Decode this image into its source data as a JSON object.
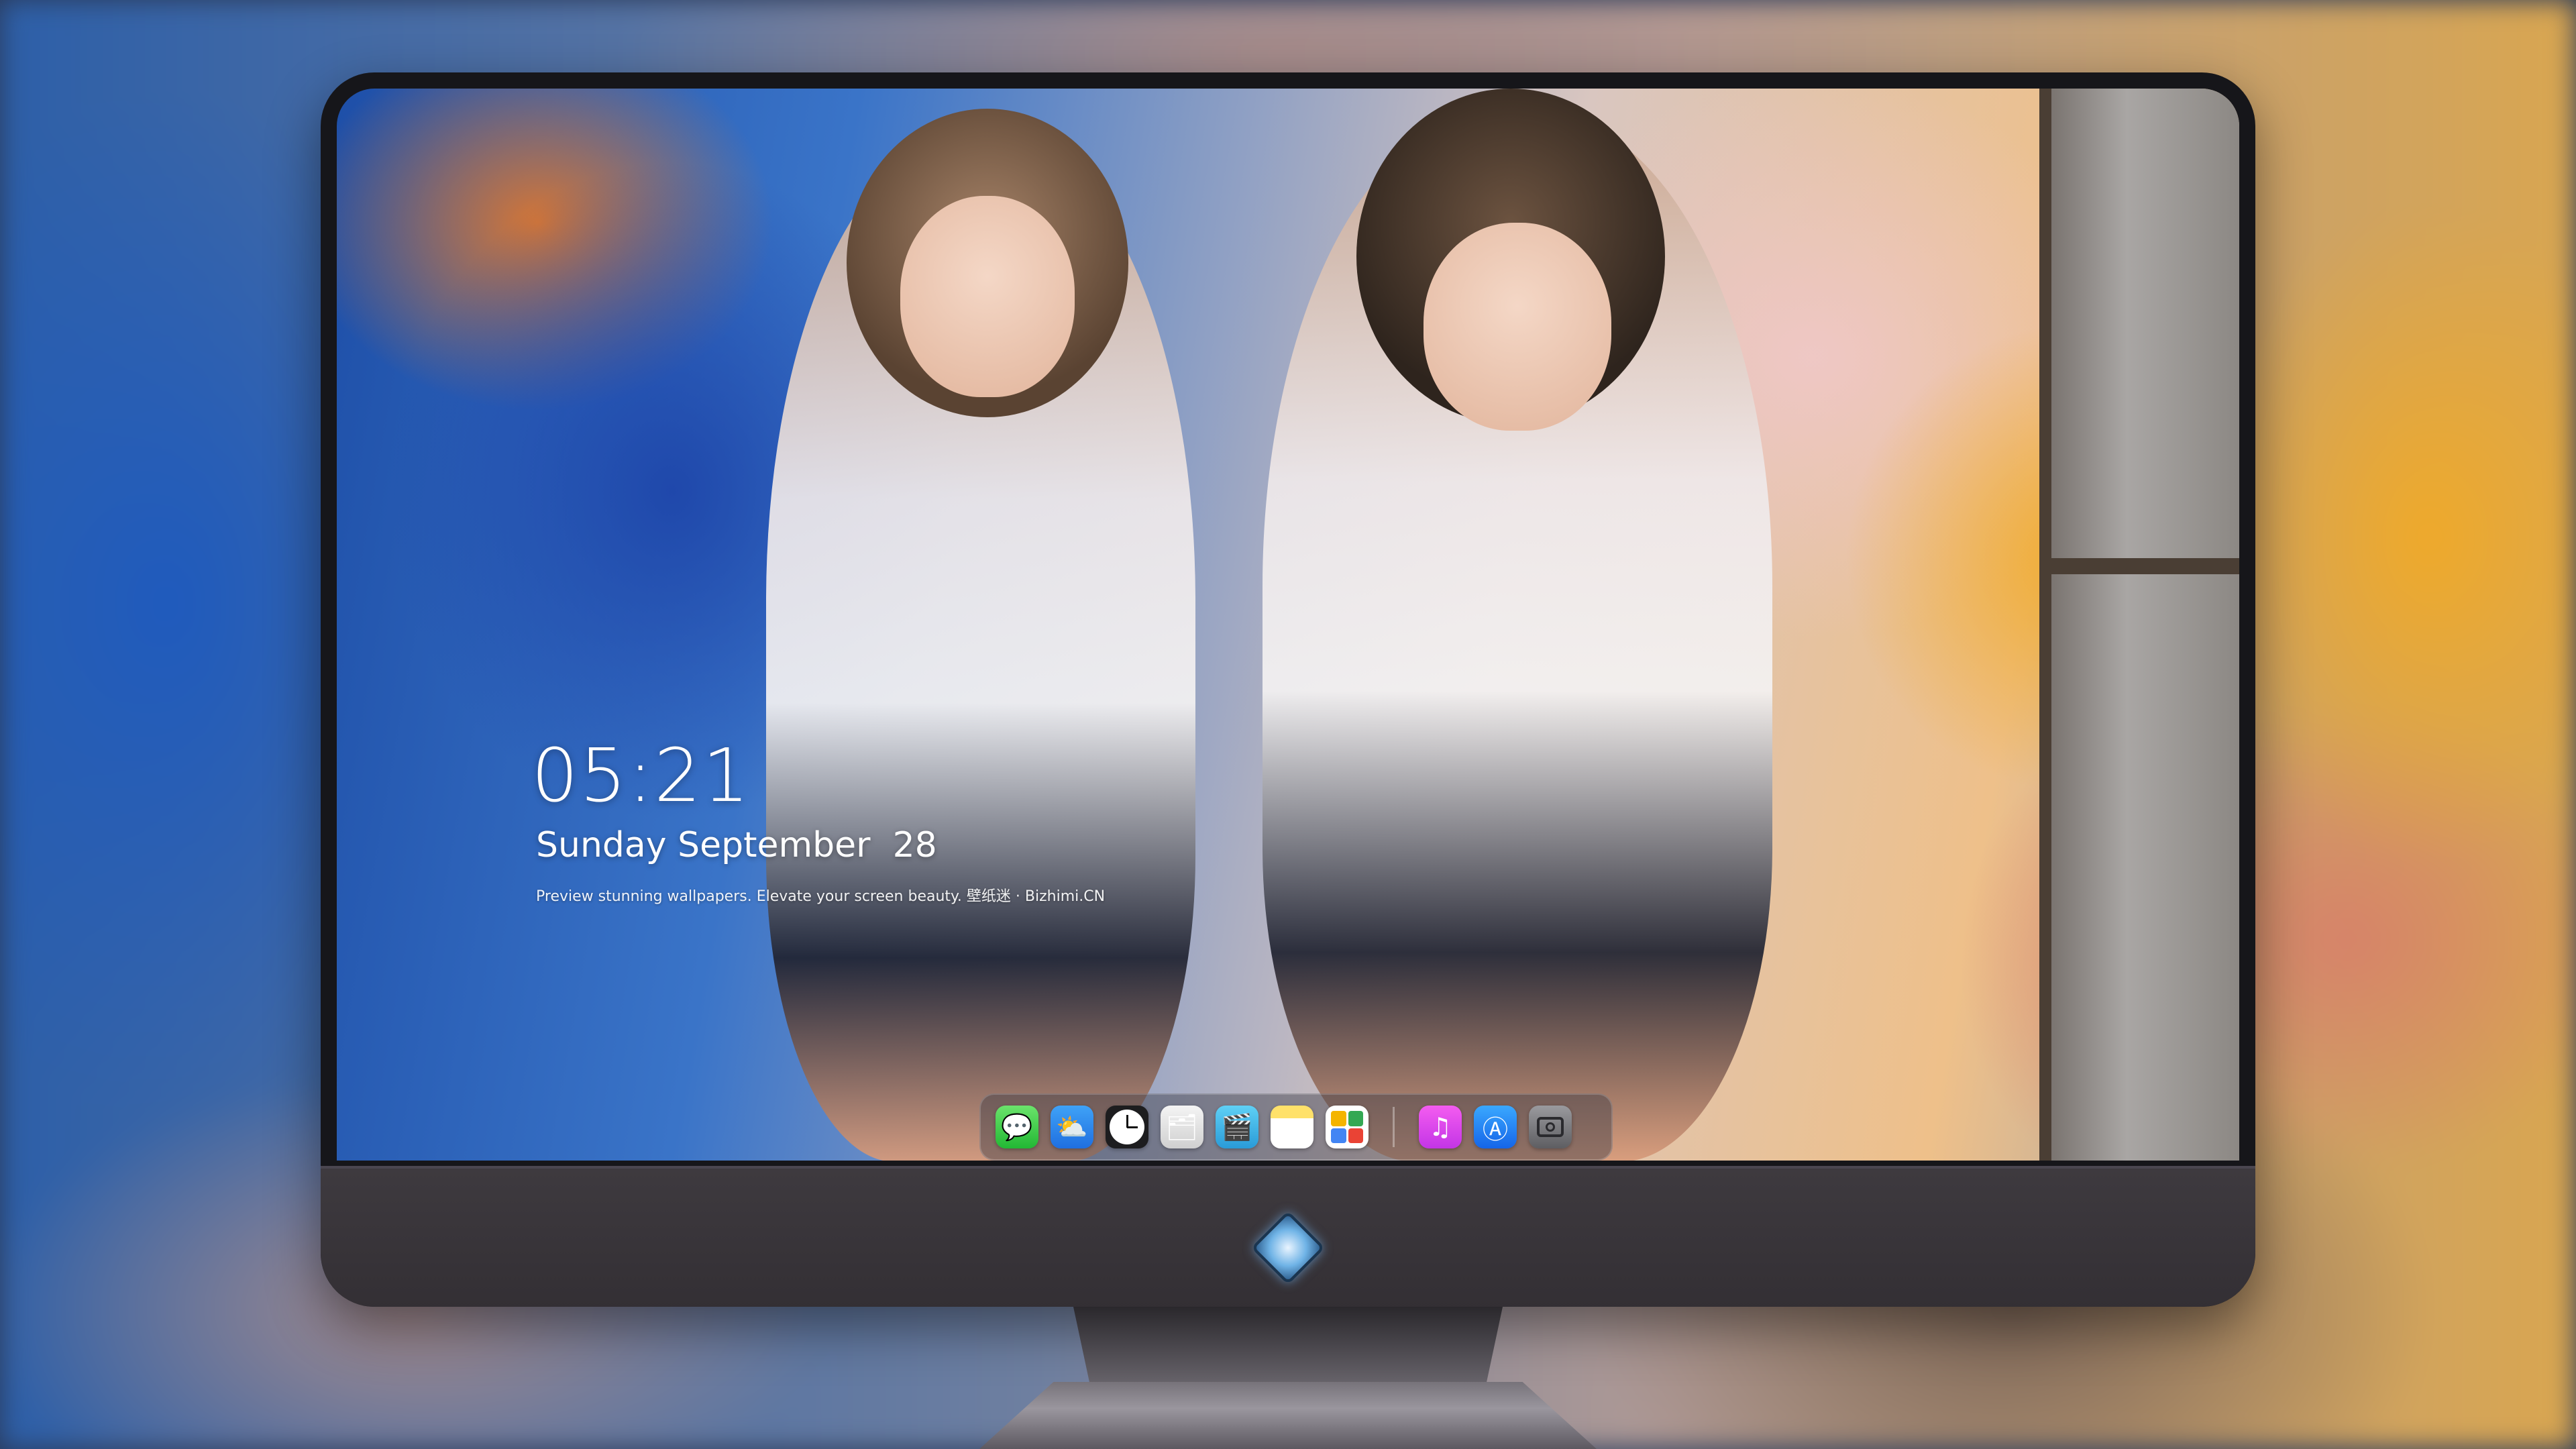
{
  "lockscreen": {
    "time": "05:21",
    "date": "Sunday September  28",
    "tagline": "Preview stunning wallpapers. Elevate your screen beauty. 壁纸迷 · Bizhimi.CN"
  },
  "dock": {
    "apps": [
      {
        "name": "Messages",
        "icon": "messages-icon",
        "glyph": "💬"
      },
      {
        "name": "Weather",
        "icon": "weather-icon",
        "glyph": "⛅"
      },
      {
        "name": "Clock",
        "icon": "clock-icon",
        "glyph": ""
      },
      {
        "name": "Finder",
        "icon": "finder-icon",
        "glyph": "🗂"
      },
      {
        "name": "Clips",
        "icon": "clapperboard-icon",
        "glyph": "🎬"
      },
      {
        "name": "Notes",
        "icon": "notes-icon",
        "glyph": ""
      },
      {
        "name": "Photos",
        "icon": "photos-icon",
        "glyph": ""
      },
      {
        "name": "Music",
        "icon": "music-note-icon",
        "glyph": "♫"
      },
      {
        "name": "App Store",
        "icon": "app-store-icon",
        "glyph": "Ⓐ"
      },
      {
        "name": "Camera",
        "icon": "camera-icon",
        "glyph": ""
      }
    ]
  },
  "chin": {
    "logo": "cat-diamond-logo"
  },
  "colors": {
    "monitor_bezel": "#16161a",
    "chin": "#3e3a3f",
    "text": "#ffffff"
  }
}
